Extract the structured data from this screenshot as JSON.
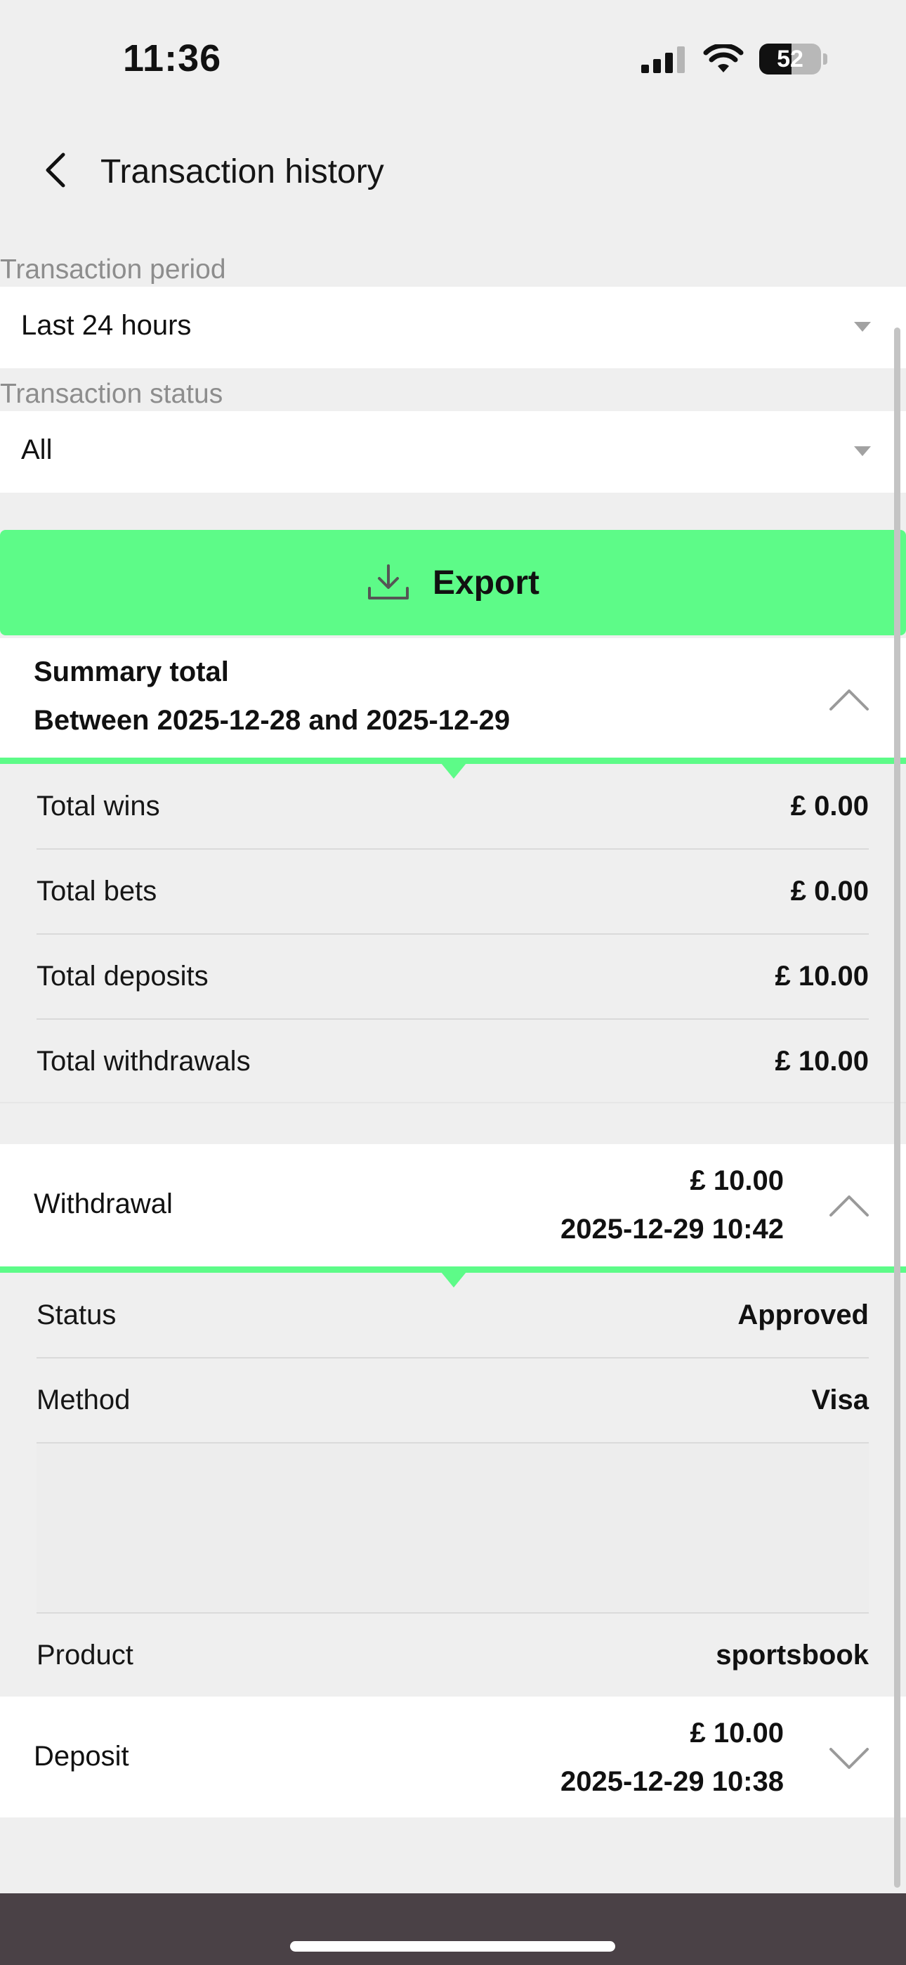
{
  "status_bar": {
    "time": "11:36",
    "battery": "52"
  },
  "header": {
    "title": "Transaction history"
  },
  "filters": {
    "period": {
      "label": "Transaction period",
      "value": "Last 24 hours"
    },
    "status": {
      "label": "Transaction status",
      "value": "All"
    }
  },
  "export": {
    "label": "Export"
  },
  "summary": {
    "title": "Summary total",
    "range": "Between 2025-12-28 and 2025-12-29",
    "rows": [
      {
        "label": "Total wins",
        "value": "£ 0.00"
      },
      {
        "label": "Total bets",
        "value": "£ 0.00"
      },
      {
        "label": "Total deposits",
        "value": "£ 10.00"
      },
      {
        "label": "Total withdrawals",
        "value": "£ 10.00"
      }
    ]
  },
  "transactions": [
    {
      "type": "Withdrawal",
      "amount": "£ 10.00",
      "datetime": "2025-12-29 10:42",
      "expanded": true,
      "details": [
        {
          "label": "Status",
          "value": "Approved"
        },
        {
          "label": "Method",
          "value": "Visa"
        },
        {
          "label": "Product",
          "value": "sportsbook"
        }
      ]
    },
    {
      "type": "Deposit",
      "amount": "£ 10.00",
      "datetime": "2025-12-29 10:38",
      "expanded": false
    }
  ],
  "colors": {
    "accent": "#5dfb88",
    "background": "#efefef",
    "bottom_bar": "#4a4146"
  },
  "icons": [
    "back-chevron-icon",
    "download-icon",
    "chevron-up-icon",
    "chevron-down-icon",
    "signal-icon",
    "wifi-icon",
    "battery-icon"
  ]
}
